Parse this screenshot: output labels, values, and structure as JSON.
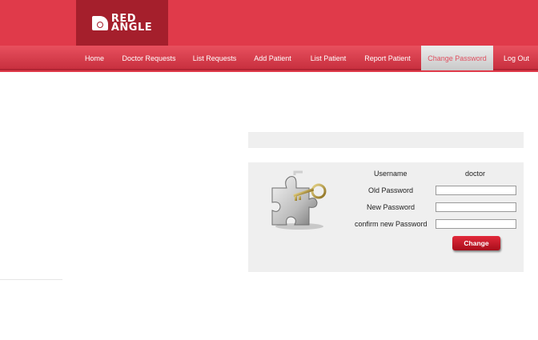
{
  "header": {
    "logo_line1": "RED",
    "logo_line2": "ANGLE",
    "nav": [
      {
        "label": "Home"
      },
      {
        "label": "Doctor Requests"
      },
      {
        "label": "List Requests"
      },
      {
        "label": "Add Patient"
      },
      {
        "label": "List Patient"
      },
      {
        "label": "Report Patient"
      },
      {
        "label": "Change Password"
      },
      {
        "label": "Log Out"
      }
    ],
    "active_item": "Change Password"
  },
  "form": {
    "username_label": "Username",
    "username_value": "doctor",
    "old_password_label": "Old Password",
    "new_password_label": "New Password",
    "confirm_password_label": "confirm new Password",
    "old_password_value": "",
    "new_password_value": "",
    "confirm_password_value": "",
    "submit_label": "Change"
  },
  "colors": {
    "header_red": "#e03a4a",
    "logo_box": "#a51f2c",
    "panel_grey": "#efefef",
    "active_tab_text": "#e05060"
  },
  "icons": {
    "illustration": "puzzle-key-icon"
  }
}
